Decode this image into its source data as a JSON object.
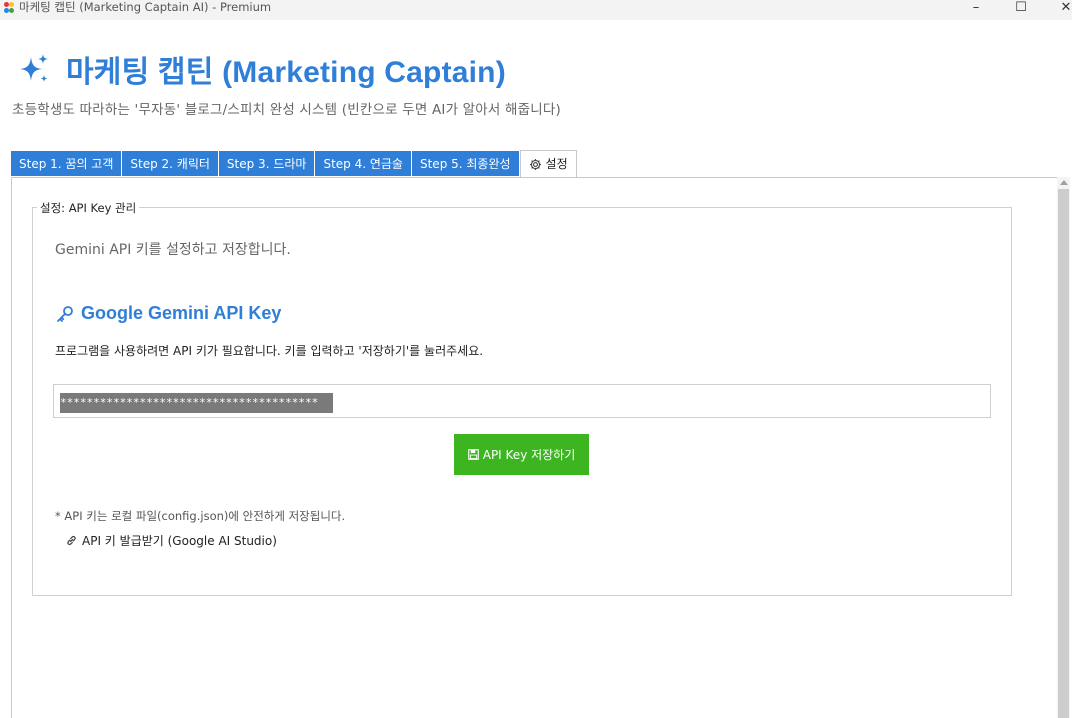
{
  "window": {
    "title": "마케팅 캡틴 (Marketing Captain AI) - Premium",
    "minimize_label": "–",
    "maximize_label": "☐",
    "close_label": "✕"
  },
  "header": {
    "title": "마케팅 캡틴 (Marketing Captain)",
    "title_icon": "sparkles-icon",
    "subtitle": "초등학생도 따라하는 '무자동' 블로그/스피치 완성 시스템 (빈칸으로 두면 AI가 알아서 해줍니다)"
  },
  "tabs": [
    {
      "label": "Step 1. 꿈의 고객"
    },
    {
      "label": "Step 2. 캐릭터"
    },
    {
      "label": "Step 3. 드라마"
    },
    {
      "label": "Step 4. 연금술"
    },
    {
      "label": "Step 5. 최종완성"
    },
    {
      "label": "설정",
      "icon": "gear-icon",
      "active": true
    }
  ],
  "settings": {
    "group_title": "설정: API Key 관리",
    "description": "Gemini API 키를 설정하고 저장합니다.",
    "api_heading": "Google Gemini API Key",
    "api_heading_icon": "key-icon",
    "instruction": "프로그램을 사용하려면 API 키가 필요합니다. 키를 입력하고 '저장하기'를 눌러주세요.",
    "key_value": "***************************************",
    "save_button_label": "API Key 저장하기",
    "save_button_icon": "floppy-disk-icon",
    "note": "* API 키는 로컬 파일(config.json)에 안전하게 저장됩니다.",
    "issue_link_label": "API 키 발급받기 (Google AI Studio)",
    "issue_link_icon": "link-icon"
  },
  "colors": {
    "accent": "#2f7ed8",
    "save_button": "#3cb521",
    "masked_key_bg": "#7a7a7a"
  }
}
